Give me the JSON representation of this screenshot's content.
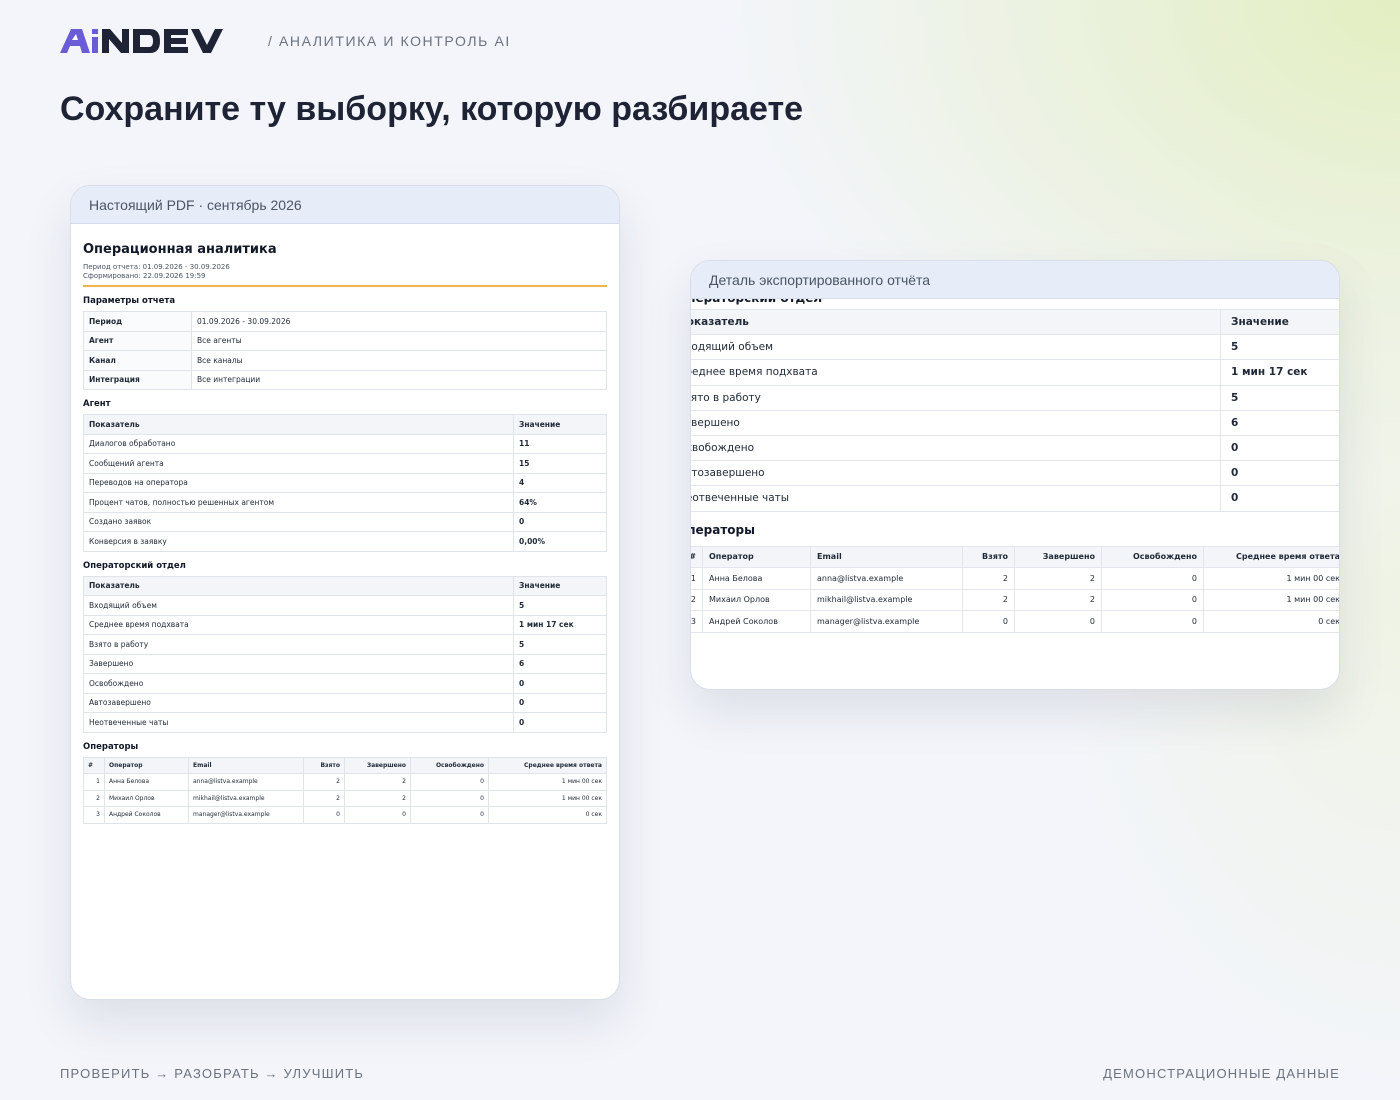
{
  "brand": {
    "logo_text": "AiNDEV",
    "tagline": "/ АНАЛИТИКА И КОНТРОЛЬ AI",
    "colors": {
      "logo_accent": "#6a5bd6",
      "logo_dark": "#1e2435",
      "accent_rule": "#f2b54a"
    }
  },
  "page_title": "Сохраните ту выборку, которую разбираете",
  "pdf_card": {
    "caption": "Настоящий PDF · сентябрь 2026",
    "title": "Операционная аналитика",
    "period_line": "Период отчета: 01.09.2026 - 30.09.2026",
    "generated_line": "Сформировано: 22.09.2026 19:59",
    "params": {
      "heading": "Параметры отчета",
      "rows": [
        {
          "key": "Период",
          "value": "01.09.2026 - 30.09.2026"
        },
        {
          "key": "Агент",
          "value": "Все агенты"
        },
        {
          "key": "Канал",
          "value": "Все каналы"
        },
        {
          "key": "Интеграция",
          "value": "Все интеграции"
        }
      ]
    },
    "agent": {
      "heading": "Агент",
      "col_metric": "Показатель",
      "col_value": "Значение",
      "rows": [
        {
          "metric": "Диалогов обработано",
          "value": "11"
        },
        {
          "metric": "Сообщений агента",
          "value": "15"
        },
        {
          "metric": "Переводов на оператора",
          "value": "4"
        },
        {
          "metric": "Процент чатов, полностью решенных агентом",
          "value": "64%"
        },
        {
          "metric": "Создано заявок",
          "value": "0"
        },
        {
          "metric": "Конверсия в заявку",
          "value": "0,00%"
        }
      ]
    },
    "ops_dept": {
      "heading": "Операторский отдел",
      "col_metric": "Показатель",
      "col_value": "Значение",
      "rows": [
        {
          "metric": "Входящий объем",
          "value": "5"
        },
        {
          "metric": "Среднее время подхвата",
          "value": "1 мин 17 сек"
        },
        {
          "metric": "Взято в работу",
          "value": "5"
        },
        {
          "metric": "Завершено",
          "value": "6"
        },
        {
          "metric": "Освобождено",
          "value": "0"
        },
        {
          "metric": "Автозавершено",
          "value": "0"
        },
        {
          "metric": "Неотвеченные чаты",
          "value": "0"
        }
      ]
    },
    "operators": {
      "heading": "Операторы",
      "columns": [
        "#",
        "Оператор",
        "Email",
        "Взято",
        "Завершено",
        "Освобождено",
        "Среднее время ответа"
      ],
      "rows": [
        {
          "n": "1",
          "name": "Анна Белова",
          "email": "anna@listva.example",
          "taken": "2",
          "done": "2",
          "released": "0",
          "avg": "1 мин 00 сек"
        },
        {
          "n": "2",
          "name": "Михаил Орлов",
          "email": "mikhail@listva.example",
          "taken": "2",
          "done": "2",
          "released": "0",
          "avg": "1 мин 00 сек"
        },
        {
          "n": "3",
          "name": "Андрей Соколов",
          "email": "manager@listva.example",
          "taken": "0",
          "done": "0",
          "released": "0",
          "avg": "0 сек"
        }
      ]
    }
  },
  "detail_card": {
    "caption": "Деталь экспортированного отчёта"
  },
  "footer": {
    "left": "ПРОВЕРИТЬ → РАЗОБРАТЬ → УЛУЧШИТЬ",
    "right": "ДЕМОНСТРАЦИОННЫЕ ДАННЫЕ"
  }
}
